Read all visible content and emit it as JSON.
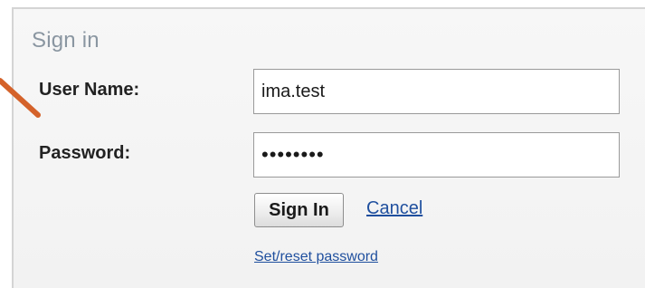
{
  "signin_panel": {
    "title": "Sign in",
    "username_label": "User Name:",
    "username_value": "ima.test",
    "password_label": "Password:",
    "password_value": "••••••••",
    "signin_button_label": "Sign In",
    "cancel_link_label": "Cancel",
    "reset_password_link_label": "Set/reset password"
  },
  "colors": {
    "annotation_arrow": "#d4622a",
    "link": "#1f4f9e",
    "title": "#8a96a1"
  }
}
